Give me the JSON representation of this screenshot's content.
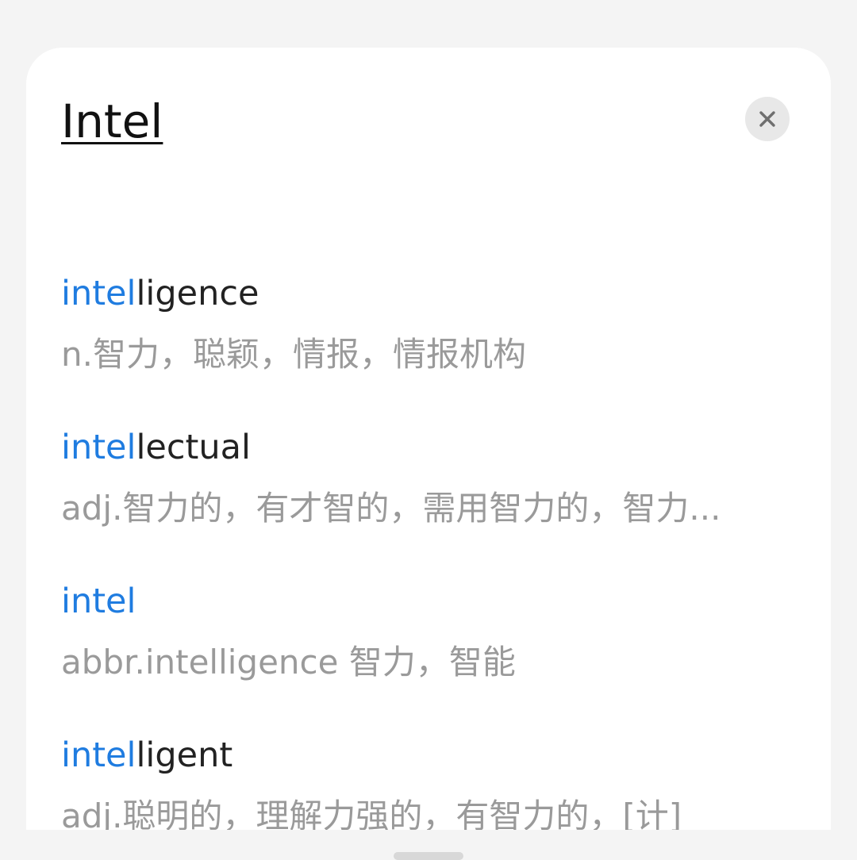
{
  "header": {
    "query": "Intel",
    "close_icon": "close-icon"
  },
  "colors": {
    "accent": "#1f7ce0",
    "word_text": "#222222",
    "definition_text": "#9a9a9a",
    "sheet_background": "#ffffff",
    "page_background": "#f4f4f4",
    "close_button_background": "#e8e8e8"
  },
  "suggestions": [
    {
      "match": "intel",
      "rest": "ligence",
      "definition": "n.智力，聪颖，情报，情报机构"
    },
    {
      "match": "intel",
      "rest": "lectual",
      "definition": "adj.智力的，有才智的，需用智力的，智力..."
    },
    {
      "match": "intel",
      "rest": "",
      "definition": "abbr.intelligence 智力，智能"
    },
    {
      "match": "intel",
      "rest": "ligent",
      "definition": "adj.聪明的，理解力强的，有智力的，[计]"
    }
  ]
}
